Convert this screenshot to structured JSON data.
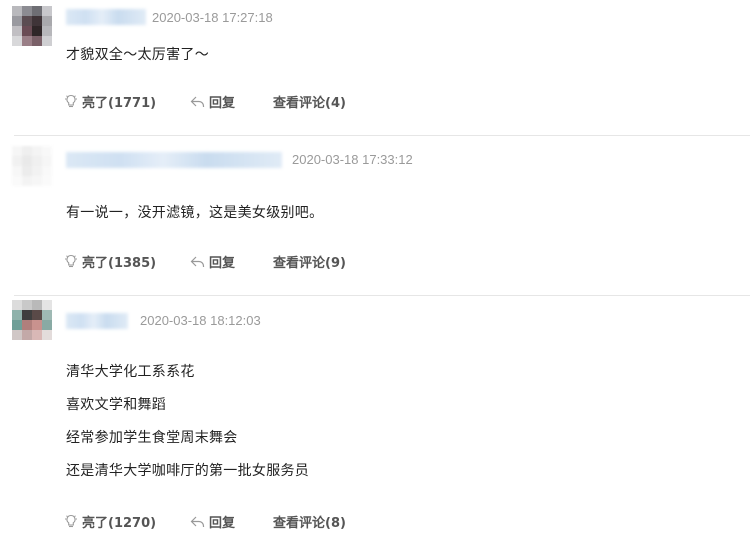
{
  "comments": [
    {
      "time": "2020-03-18 17:27:18",
      "lines": [
        "才貌双全～太厉害了～"
      ],
      "like_label": "亮了(1771)",
      "reply_label": "回复",
      "view_replies_label": "查看评论(4)"
    },
    {
      "time": "2020-03-18 17:33:12",
      "lines": [
        "有一说一，没开滤镜，这是美女级别吧。"
      ],
      "like_label": "亮了(1385)",
      "reply_label": "回复",
      "view_replies_label": "查看评论(9)"
    },
    {
      "time": "2020-03-18 18:12:03",
      "lines": [
        "清华大学化工系系花",
        "喜欢文学和舞蹈",
        "经常参加学生食堂周末舞会",
        "还是清华大学咖啡厅的第一批女服务员"
      ],
      "like_label": "亮了(1270)",
      "reply_label": "回复",
      "view_replies_label": "查看评论(8)"
    }
  ],
  "icons": {
    "like": "lightbulb-icon",
    "reply": "reply-arrow-icon"
  },
  "colors": {
    "meta_text": "#9a9a9a",
    "action_text": "#555555",
    "divider": "#e6e6e6"
  }
}
